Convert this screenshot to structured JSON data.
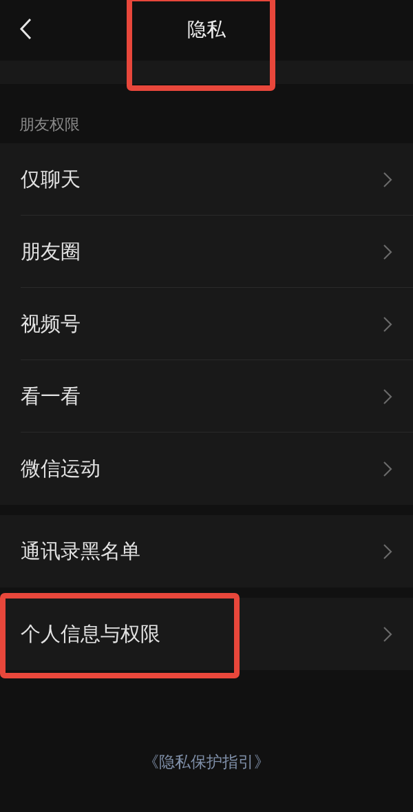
{
  "header": {
    "title": "隐私",
    "highlighted": true
  },
  "section_label": "朋友权限",
  "groups": [
    {
      "items": [
        {
          "label": "仅聊天",
          "highlighted": false
        },
        {
          "label": "朋友圈",
          "highlighted": false
        },
        {
          "label": "视频号",
          "highlighted": false
        },
        {
          "label": "看一看",
          "highlighted": false
        },
        {
          "label": "微信运动",
          "highlighted": false
        }
      ]
    },
    {
      "items": [
        {
          "label": "通讯录黑名单",
          "highlighted": false
        }
      ]
    },
    {
      "items": [
        {
          "label": "个人信息与权限",
          "highlighted": true
        }
      ]
    }
  ],
  "footer_link": "《隐私保护指引》"
}
